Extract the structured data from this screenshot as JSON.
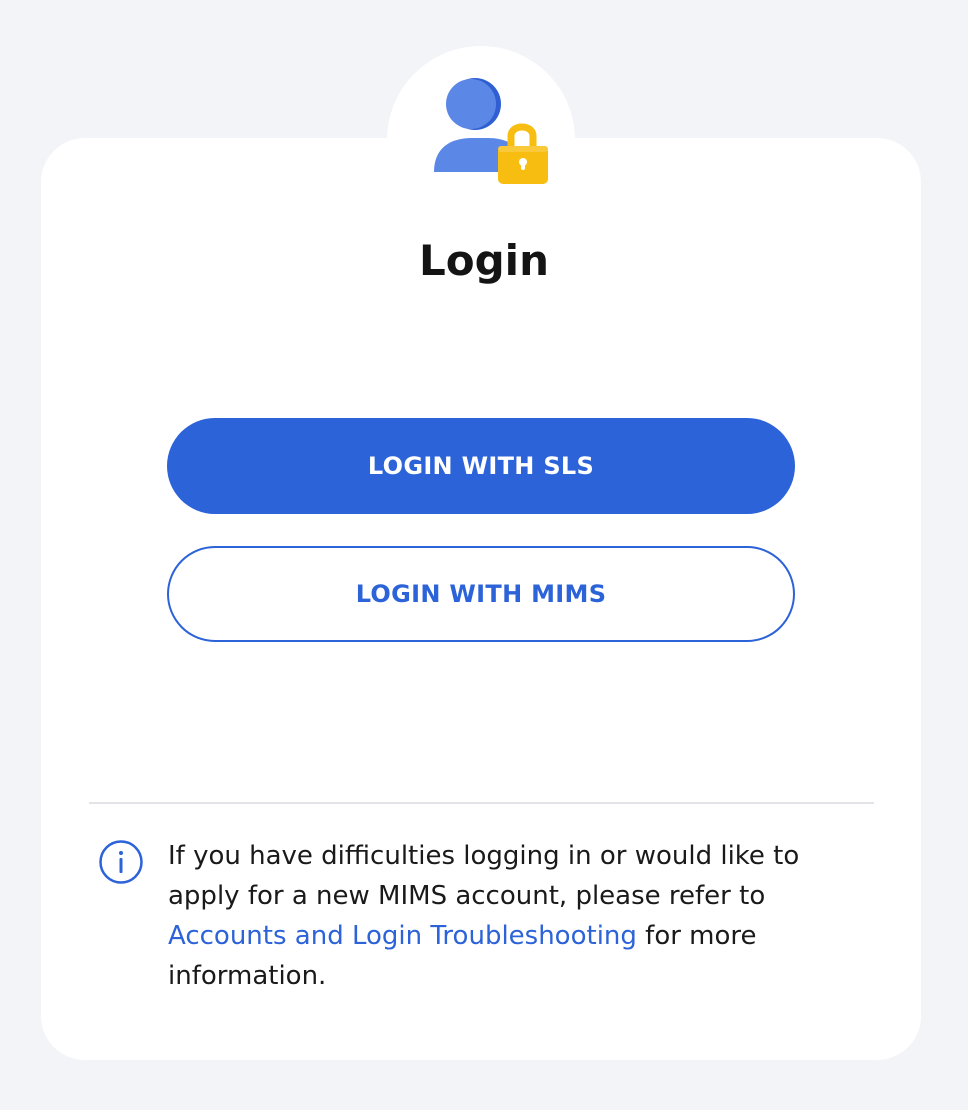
{
  "page": {
    "title": "Login"
  },
  "buttons": {
    "sls_label": "LOGIN WITH SLS",
    "mims_label": "LOGIN WITH MIMS"
  },
  "info": {
    "text_before": "If you have difficulties logging in or would like to apply for a new MIMS account, please refer to ",
    "link_text": "Accounts and Login Troubleshooting",
    "text_after": " for more information."
  },
  "icons": {
    "avatar": "user-lock-icon",
    "info": "info-icon"
  },
  "colors": {
    "primary": "#2c63d8",
    "background": "#f3f4f8",
    "card": "#ffffff",
    "lock": "#f7bd10"
  }
}
